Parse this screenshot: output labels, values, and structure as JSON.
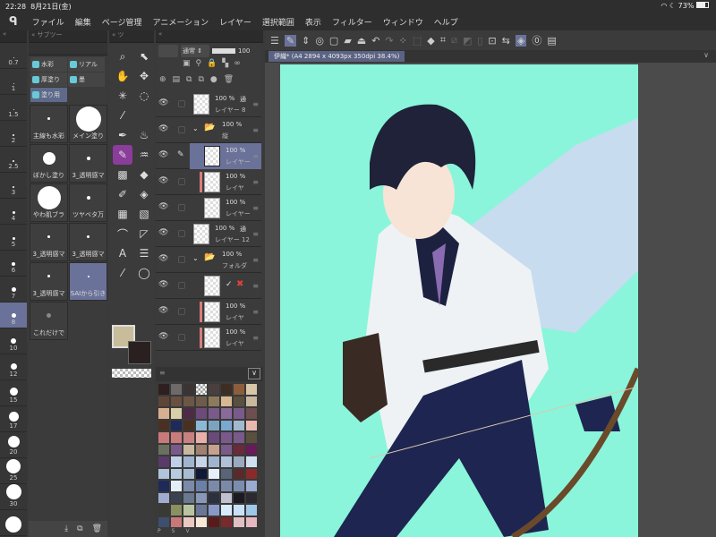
{
  "status": {
    "time": "22:28",
    "date": "8月21日(金)",
    "battery": "73%"
  },
  "menu": [
    "ファイル",
    "編集",
    "ページ管理",
    "アニメーション",
    "レイヤー",
    "選択範囲",
    "表示",
    "フィルター",
    "ウィンドウ",
    "ヘルプ"
  ],
  "brush_sizes": [
    {
      "label": "0.7",
      "d": 1
    },
    {
      "label": "1",
      "d": 1
    },
    {
      "label": "1.5",
      "d": 1
    },
    {
      "label": "2",
      "d": 2
    },
    {
      "label": "2.5",
      "d": 2
    },
    {
      "label": "3",
      "d": 2
    },
    {
      "label": "4",
      "d": 3
    },
    {
      "label": "5",
      "d": 3
    },
    {
      "label": "6",
      "d": 4
    },
    {
      "label": "7",
      "d": 5
    },
    {
      "label": "8",
      "d": 5,
      "selected": true
    },
    {
      "label": "10",
      "d": 6
    },
    {
      "label": "12",
      "d": 7
    },
    {
      "label": "15",
      "d": 9
    },
    {
      "label": "17",
      "d": 11
    },
    {
      "label": "20",
      "d": 13
    },
    {
      "label": "25",
      "d": 16
    },
    {
      "label": "30",
      "d": 17
    },
    {
      "label": "",
      "d": 18
    }
  ],
  "subtool": {
    "header": "サブツー",
    "tabs": [
      {
        "label": "水彩"
      },
      {
        "label": "リアル"
      },
      {
        "label": "厚塗り"
      },
      {
        "label": "墨"
      },
      {
        "label": "塗り用",
        "selected": true
      }
    ],
    "brushes": [
      {
        "label": "主線も水彩",
        "d": 3
      },
      {
        "label": "メイン塗り",
        "d": 28
      },
      {
        "label": "ぼかし塗り",
        "d": 14
      },
      {
        "label": "3_透明感マ",
        "d": 4
      },
      {
        "label": "やわ肌ブラ",
        "d": 26
      },
      {
        "label": "ツヤベタ万",
        "d": 4
      },
      {
        "label": "3_透明感マ",
        "d": 3
      },
      {
        "label": "3_透明感マ",
        "d": 3
      },
      {
        "label": "3_透明感マ",
        "d": 3
      },
      {
        "label": "SAIから引き",
        "d": 2,
        "selected": true
      },
      {
        "label": "これだけで",
        "d": 5
      }
    ]
  },
  "tool_header": "ツ",
  "layers": {
    "blend_mode": "通常",
    "opacity": "100",
    "items": [
      {
        "opacity": "100 %",
        "mode": "通",
        "name": "レイヤー 8",
        "indent": 0
      },
      {
        "opacity": "100 %",
        "name": "縦",
        "indent": 0,
        "folder": true
      },
      {
        "opacity": "100 %",
        "name": "レイヤー",
        "indent": 1,
        "selected": true,
        "pen": true
      },
      {
        "opacity": "100 %",
        "name": "レイヤ",
        "indent": 1,
        "clip": true
      },
      {
        "opacity": "100 %",
        "name": "レイヤー",
        "indent": 1
      },
      {
        "opacity": "100 %",
        "mode": "通",
        "name": "レイヤー 12",
        "indent": 0
      },
      {
        "opacity": "100 %",
        "name": "フォルダ",
        "indent": 0,
        "folder": true
      },
      {
        "opacity": "",
        "name": "",
        "indent": 1,
        "mask": true
      },
      {
        "opacity": "100 %",
        "name": "レイヤ",
        "indent": 1,
        "clip": true
      },
      {
        "opacity": "100 %",
        "name": "レイヤ",
        "indent": 1,
        "clip": true
      }
    ]
  },
  "colors": {
    "main": "#c8bd9a",
    "sub": "#2a2020",
    "accent": "#6a7299",
    "canvas_bg": "#8af5da"
  },
  "palette": [
    "#2e2020",
    "#6e6a6a",
    "#3a3434",
    "checker",
    "#4a3f3f",
    "#3c2e22",
    "#8c5e3c",
    "#d8c8a8",
    "#5e4636",
    "#6a5040",
    "#6e5646",
    "#6e5c4a",
    "#8c7a5c",
    "#d8b890",
    "#5a5040",
    "#c8b8a0",
    "#d8b090",
    "#d8d0a8",
    "#4e2a46",
    "#6e4a7a",
    "#7a5a8a",
    "#8a6a9a",
    "#7a5a8a",
    "#6e4e4e",
    "#4a3022",
    "#1e2a58",
    "#4a3020",
    "#8cb8d8",
    "#7ca4c0",
    "#7aa8d0",
    "#a0b8d0",
    "#e8b8b0",
    "#c87a7a",
    "#c87c7c",
    "#c88080",
    "#e8b0a8",
    "#6a4a7a",
    "#7a5a8a",
    "#7a5a8a",
    "#5a5040",
    "#6a7060",
    "#7a5a8a",
    "#c8b8a0",
    "#a08070",
    "#c8a090",
    "#7a5a8a",
    "#6a2a3a",
    "#6a1a5a",
    "#5a3a6a",
    "#c0d0e8",
    "#a0b4d0",
    "#c8d4e8",
    "#a0b4d0",
    "#b0c0d8",
    "#9aa8c0",
    "#d0e0f0",
    "#b0c4dc",
    "#b8cce0",
    "#a8bcd4",
    "#101838",
    "#e8f0fc",
    "#5a6478",
    "#5a2a2a",
    "#8a2a2a",
    "#1e2a58",
    "#e4ecf8",
    "#7a8aa8",
    "#6a80a8",
    "#7a8aa8",
    "#7a8aa8",
    "#7a8cb0",
    "#9aaad0",
    "#a0acd0",
    "#3a4250",
    "#6a7890",
    "#8898b8",
    "#2a3040",
    "#c0c0d0",
    "#1a1a20",
    "#2a2a30",
    "#3a3a34",
    "#8a9060",
    "#b8c4a0",
    "#6a7898",
    "#8a98c8",
    "#d8ecfc",
    "#c8e0f8",
    "#a0c8e8",
    "#3e4e6e",
    "#c87878",
    "#e8c8c0",
    "#f8e8d8",
    "#5a1a1a",
    "#7a2a2a",
    "#e0c0c0",
    "#e8b8c0"
  ],
  "palette_footer": [
    "P",
    "S",
    "V"
  ],
  "document": {
    "tab": "伊織* (A4 2894 x 4093px 350dpi 38.4%)"
  }
}
